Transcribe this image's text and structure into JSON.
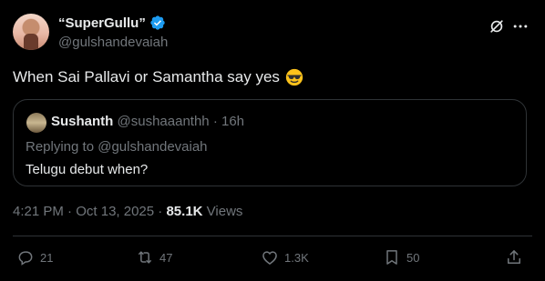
{
  "author": {
    "display_name": "“SuperGullu”",
    "handle": "@gulshandevaiah",
    "verified": true,
    "verified_color": "#1d9bf0"
  },
  "tweet": {
    "text": "When Sai Pallavi or Samantha say yes",
    "emoji": "smiling-face-with-sunglasses"
  },
  "quote": {
    "author_name": "Sushanth",
    "author_handle": "@sushaaanthh",
    "separator": "·",
    "age": "16h",
    "replying_to": "Replying to @gulshandevaiah",
    "text": "Telugu debut when?"
  },
  "meta": {
    "time": "4:21 PM",
    "dot1": "·",
    "date": "Oct 13, 2025",
    "dot2": "·",
    "views_count": "85.1K",
    "views_label": "Views"
  },
  "actions": {
    "replies": "21",
    "reposts": "47",
    "likes": "1.3K",
    "bookmarks": "50"
  },
  "icons": {
    "top_right": [
      "grok-icon",
      "more-icon"
    ],
    "actions": [
      "reply-icon",
      "repost-icon",
      "like-icon",
      "bookmark-icon",
      "share-icon"
    ]
  },
  "colors": {
    "background": "#000000",
    "text": "#e7e9ea",
    "secondary": "#71767b",
    "border": "#2f3336"
  }
}
